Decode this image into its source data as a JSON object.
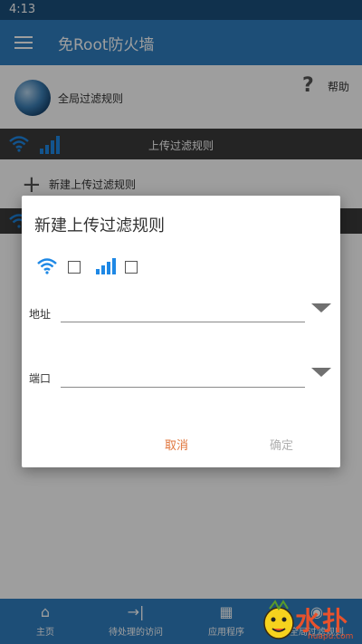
{
  "status_bar": {
    "time": "4:13"
  },
  "app_bar": {
    "title": "免Root防火墙",
    "menu_icon": "hamburger-menu-icon"
  },
  "global_rules": {
    "label": "全局过滤规则",
    "icon": "globe-icon"
  },
  "help": {
    "icon": "question-mark-icon",
    "label": "帮助"
  },
  "upload_section": {
    "title": "上传过滤规则",
    "icons": [
      "wifi-icon",
      "cellular-signal-icon"
    ]
  },
  "new_rule": {
    "label": "新建上传过滤规则",
    "icon": "plus-icon"
  },
  "dialog": {
    "title": "新建上传过滤规则",
    "wifi_checked": false,
    "cellular_checked": false,
    "fields": [
      {
        "label": "地址",
        "value": ""
      },
      {
        "label": "端口",
        "value": ""
      }
    ],
    "cancel_label": "取消",
    "ok_label": "确定"
  },
  "bottom_nav": [
    {
      "label": "主页",
      "icon": "home-icon"
    },
    {
      "label": "待处理的访问",
      "icon": "arrow-to-bar-icon"
    },
    {
      "label": "应用程序",
      "icon": "grid-icon"
    },
    {
      "label": "全局过滤规则",
      "icon": "globe-icon"
    }
  ],
  "watermark": {
    "text": "水扑",
    "sub": "huapu.com"
  },
  "colors": {
    "primary": "#2f7fc1",
    "status_bar": "#1a4f7c",
    "section_header": "#3a3a3a",
    "accent": "#e0743a",
    "icon_blue": "#1e88e5"
  }
}
